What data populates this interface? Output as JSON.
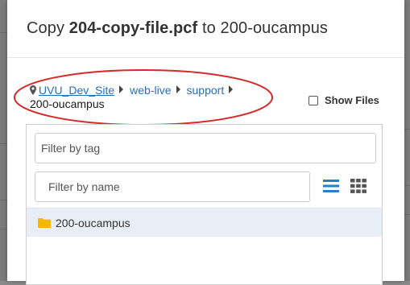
{
  "dialog": {
    "title_prefix": "Copy",
    "title_filename": "204-copy-file.pcf",
    "title_to": "to",
    "title_destination": "200-oucampus"
  },
  "breadcrumb": {
    "items": [
      "UVU_Dev_Site",
      "web-live",
      "support"
    ],
    "current": "200-oucampus"
  },
  "show_files": {
    "label": "Show Files",
    "checked": false
  },
  "filters": {
    "tag_placeholder": "Filter by tag",
    "name_placeholder": "Filter by name"
  },
  "file_list": [
    {
      "name": "200-oucampus",
      "type": "folder",
      "icon": "folder-icon"
    }
  ],
  "colors": {
    "link": "#2a6ebb",
    "view_icon": "#2a7dc8",
    "highlight_ellipse": "#d62a2a",
    "folder": "#f5b800",
    "selected_row": "#e7eef5"
  }
}
